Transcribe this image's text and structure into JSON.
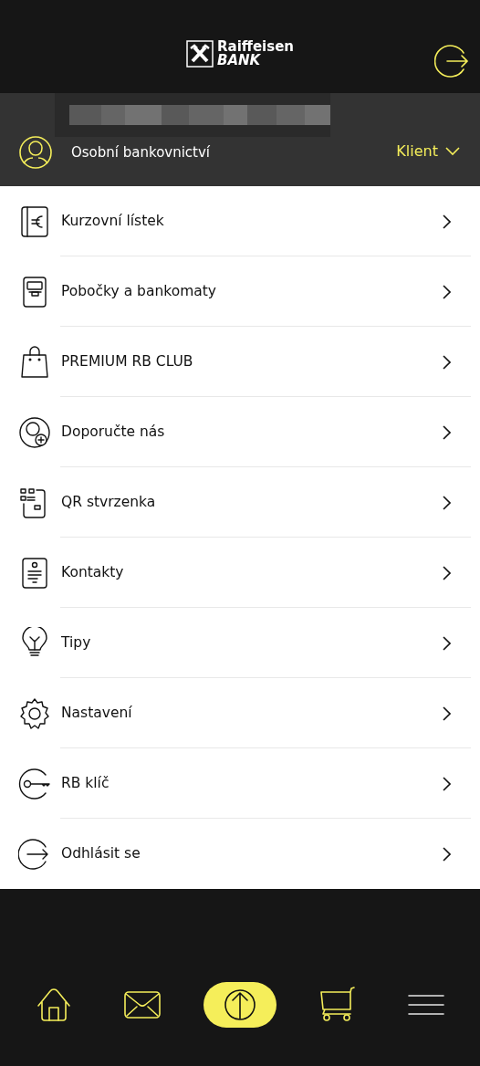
{
  "header": {
    "logo_line_1": "Raiffeisen",
    "logo_line_2": "BANK"
  },
  "profile": {
    "subtitle": "Osobní bankovnictví",
    "role": "Klient"
  },
  "menu": [
    {
      "kind": "exchange",
      "label": "Kurzovní lístek"
    },
    {
      "kind": "atm",
      "label": "Pobočky a bankomaty"
    },
    {
      "kind": "bag",
      "label": "PREMIUM RB CLUB"
    },
    {
      "kind": "refer",
      "label": "Doporučte nás"
    },
    {
      "kind": "qr",
      "label": "QR stvrzenka"
    },
    {
      "kind": "contacts",
      "label": "Kontakty"
    },
    {
      "kind": "bulb",
      "label": "Tipy"
    },
    {
      "kind": "gear",
      "label": "Nastavení"
    },
    {
      "kind": "key",
      "label": "RB klíč"
    },
    {
      "kind": "logout",
      "label": "Odhlásit se"
    }
  ],
  "bottom_nav": [
    {
      "kind": "home",
      "selected": false
    },
    {
      "kind": "mail",
      "selected": false
    },
    {
      "kind": "transfer",
      "selected": true
    },
    {
      "kind": "cart",
      "selected": false
    },
    {
      "kind": "menu",
      "selected": false
    }
  ]
}
